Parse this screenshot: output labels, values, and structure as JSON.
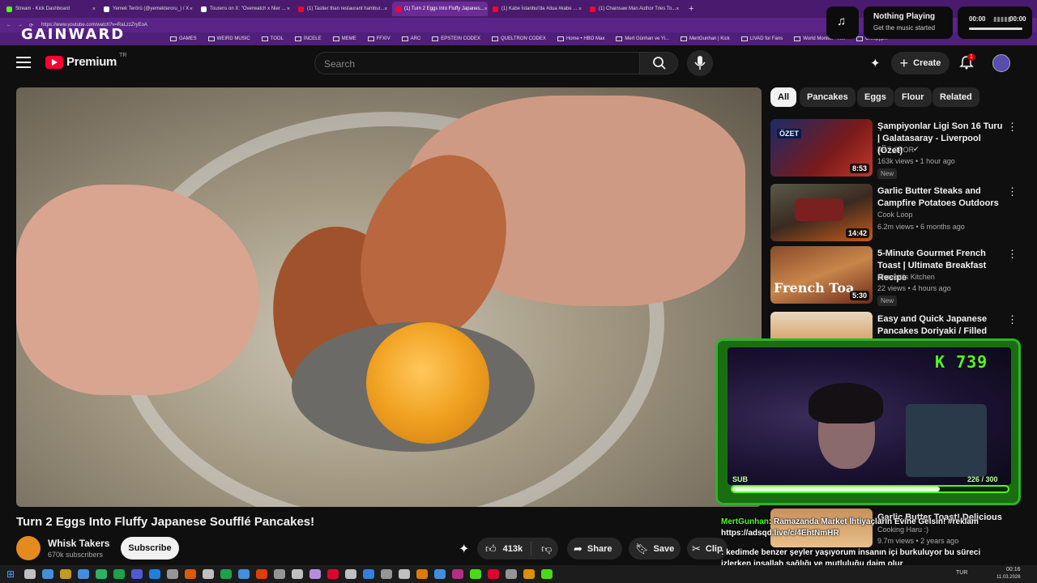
{
  "browser": {
    "tabs": [
      {
        "label": "Stream - Kick Dashboard",
        "color": "#53fc18"
      },
      {
        "label": "Yemek Terörü (@yemekteroru_) / X",
        "color": "#ffffff"
      },
      {
        "label": "Tourens on X: \"Overwatch x Nier ...",
        "color": "#ffffff"
      },
      {
        "label": "(1) Tastier than restaurant hambur...",
        "color": "#ff0033"
      },
      {
        "label": "(1) Turn 2 Eggs Into Fluffy Japanes...",
        "color": "#ff0033"
      },
      {
        "label": "(1) Kabe İstanbul'da #dua #kabe ...",
        "color": "#ff0033"
      },
      {
        "label": "(1) Chainsaw Man Author Tries To...",
        "color": "#ff0033"
      }
    ],
    "address": "https://www.youtube.com/watch?v=RaLzzZryEoA",
    "bookmarks": [
      "GAMES",
      "WEIRD MUSIC",
      "TOOL",
      "İNCELE",
      "MEME",
      "FFXIV",
      "ARC",
      "EPSTEIN CODEX",
      "QUELTRON CODEX",
      "Home • HBO Max",
      "Mert Günhan ve Yi...",
      "MertGunhan | Kick",
      "LIVAD for Fans",
      "World Monitor - R...",
      "Creepyp..."
    ],
    "overlay_logo": "GAINWARD"
  },
  "music": {
    "title": "Nothing Playing",
    "subtitle": "Get the music started",
    "time_start": "00:00",
    "time_end": "00:00"
  },
  "header": {
    "logo": "Premium",
    "region": "TR",
    "search_placeholder": "Search",
    "create_label": "Create",
    "notif_count": "1"
  },
  "chips": [
    "All",
    "Pancakes",
    "Eggs",
    "Flour",
    "Related"
  ],
  "recommendations": [
    {
      "title": "Şampiyonlar Ligi Son 16 Turu | Galatasaray - Liverpool (Özet)",
      "channel": "TRT SPOR",
      "meta": "163k views • 1 hour ago",
      "duration": "8:53",
      "badge": "New",
      "thumb_text": "ÖZET"
    },
    {
      "title": "Garlic Butter Steaks and Campfire Potatoes Outdoors",
      "channel": "Cook Loop",
      "meta": "6.2m views • 6 months ago",
      "duration": "14:42",
      "badge": ""
    },
    {
      "title": "5-Minute Gourmet French Toast | Ultimate Breakfast Recipe",
      "channel": "Mervotti's Kitchen",
      "meta": "22 views • 4 hours ago",
      "duration": "5:30",
      "badge": "New",
      "thumb_text": "French Toa"
    },
    {
      "title": "Easy and Quick Japanese Pancakes Doriyaki / Filled with...",
      "channel": "",
      "meta": "",
      "duration": "",
      "badge": ""
    },
    {
      "title": "Garlic Butter Toast! Delicious ...",
      "channel": "Cooking Haru :)",
      "meta": "9.7m views • 2 years ago",
      "duration": "",
      "badge": ""
    }
  ],
  "video": {
    "title": "Turn 2 Eggs Into Fluffy Japanese Soufflé Pancakes!",
    "channel": "Whisk Takers",
    "subscribers": "670k subscribers",
    "subscribe_label": "Subscribe",
    "likes": "413k",
    "share_label": "Share",
    "save_label": "Save",
    "clip_label": "Clip"
  },
  "stream": {
    "counter": "K 739",
    "sub_label": "SUB",
    "sub_progress_text": "226 / 300",
    "sub_progress": 0.753
  },
  "chat": [
    {
      "user": "MertGunhan",
      "text": ": Ramazanda Market İhtiyaçların Evine Gelsin! #reklam"
    },
    {
      "user": "",
      "text": "https://adsqd.live/c/4EhtNmHR"
    },
    {
      "user": "",
      "text": ": kedimde benzer şeyler yaşıyorum insanın içi burkuluyor bu süreci izlerken inşallah sağlığı ve mutluluğu daim olur"
    }
  ],
  "taskbar": {
    "lang": "TUR",
    "time": "00:16",
    "date": "11.03.2026"
  }
}
